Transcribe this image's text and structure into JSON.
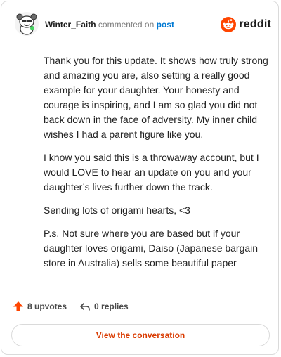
{
  "comment": {
    "author": "Winter_Faith",
    "action_text": "commented on",
    "link_text": "post"
  },
  "brand": {
    "name": "reddit",
    "color": "#ff4500"
  },
  "body": {
    "paragraphs": [
      "Thank you for this update. It shows how truly strong and amazing you are, also setting a really good example for your daughter. Your honesty and courage is inspiring, and I am so glad you did not back down in the face of adversity. My inner child wishes I had a parent figure like you.",
      "I know you said this is a throwaway account, but I would LOVE to hear an update on you and your daughter’s lives further down the track.",
      "Sending lots of origami hearts, <3",
      "P.s. Not sure where you are based but if your daughter loves origami, Daiso (Japanese bargain store in Australia) sells some beautiful paper"
    ]
  },
  "actions": {
    "upvotes": "8 upvotes",
    "replies": "0 replies",
    "upvote_icon": "upvote-arrow-icon",
    "reply_icon": "reply-arrow-icon"
  },
  "cta": {
    "label": "View the conversation"
  },
  "colors": {
    "upvote": "#ff4500",
    "link": "#0079d3",
    "cta_text": "#d93a00"
  }
}
